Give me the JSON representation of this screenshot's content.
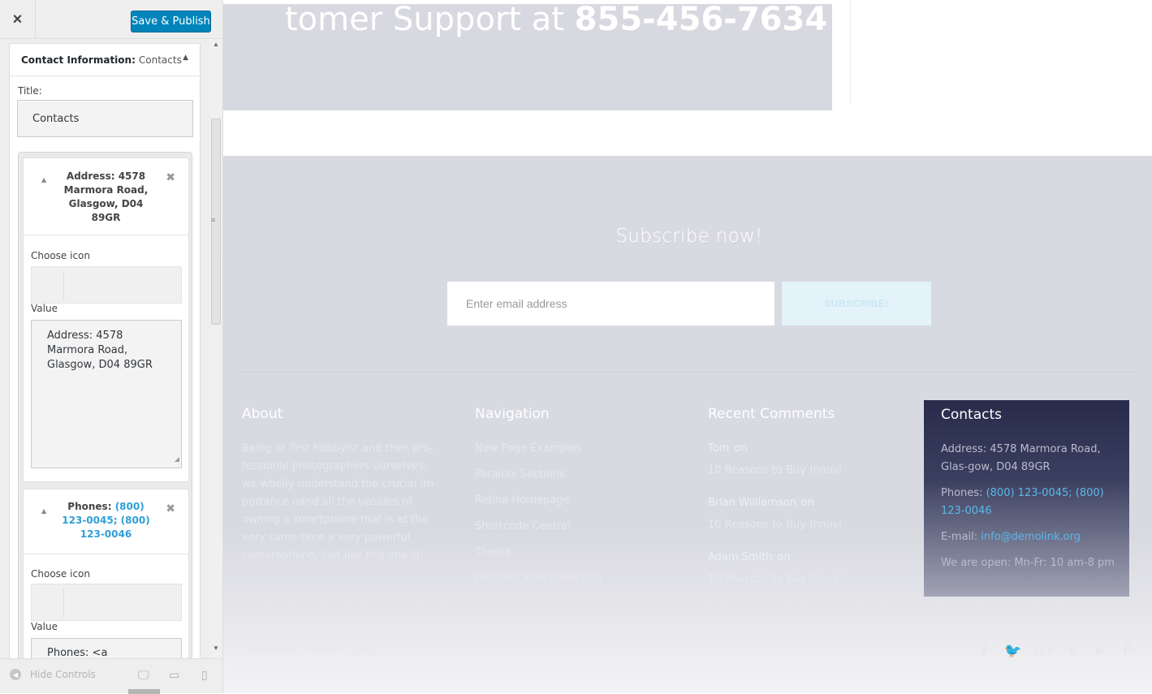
{
  "customizer": {
    "close_icon": "×",
    "publish_label": "Save & Publish",
    "widget": {
      "type_label": "Contact Information:",
      "name": "Contacts",
      "title_label": "Title:",
      "title_value": "Contacts"
    },
    "items": [
      {
        "header_line1": "Address: 4578",
        "header_line2": "Marmora Road,",
        "header_line3": "Glasgow, D04",
        "header_line4": "89GR",
        "choose_icon_label": "Choose icon",
        "value_label": "Value",
        "value_text": "Address: 4578 Marmora Road, Glasgow, D04 89GR"
      },
      {
        "header_prefix": "Phones:",
        "header_link1": "(800)",
        "header_link2": "123-0045; (800)",
        "header_link3": "123-0046",
        "choose_icon_label": "Choose icon",
        "value_label": "Value",
        "value_text": "Phones: <a"
      }
    ],
    "footer": {
      "hide_controls_label": "Hide Controls",
      "devices": [
        "desktop",
        "tablet",
        "mobile"
      ]
    }
  },
  "preview": {
    "cta": {
      "text_prefix": "tomer Support at",
      "phone": "855-456-7634"
    },
    "subscribe": {
      "title": "Subscribe now!",
      "email_placeholder": "Enter email address",
      "button_label": "SUBSCRIBE!"
    },
    "about": {
      "title": "About",
      "text": "Being at first hobbyist and then pro-fessional photographers ourselves, we wholly understand the crucial im-portance oand all the upsides of owning a smartphone that is at the very same time a very powerful cameraphone, just like this one is!"
    },
    "navigation": {
      "title": "Navigation",
      "links": [
        "New Page Examples",
        "Parallax Sections",
        "Retina Homepage",
        "Shortcode Central",
        "Theme",
        "Ultimate Font Collection"
      ]
    },
    "recent_comments": {
      "title": "Recent Comments",
      "items": [
        {
          "author": "Tom",
          "on": "on",
          "post": "10 Reasons to Buy Innovi"
        },
        {
          "author": "Brian Williamson",
          "on": "on",
          "post": "10 Reasons to Buy Innovi"
        },
        {
          "author": "Adam Smith",
          "on": "on",
          "post": "10 Reasons to Buy Innovi"
        }
      ]
    },
    "contacts": {
      "title": "Contacts",
      "address": "Address: 4578 Marmora Road, Glas-gow, D04 89GR",
      "phones_label": "Phones:",
      "phone1": "(800) 123-0045",
      "phone_sep": "; ",
      "phone2": "(800) 123-0046",
      "email_label": "E-mail:",
      "email": "info@demolink.org",
      "hours": "We are open: Mn-Fr: 10 am-8 pm"
    },
    "copyright": "OptiPhone Theme © 2017",
    "social_icons": [
      "facebook-icon",
      "twitter-icon",
      "google-plus-icon",
      "vimeo-icon",
      "youtube-icon",
      "pinterest-icon"
    ]
  },
  "colors": {
    "publish_button": "#0085ba",
    "link": "#2e9fd8",
    "contacts_bg": "#282b4a",
    "footer_bg": "#d8d9e1"
  }
}
